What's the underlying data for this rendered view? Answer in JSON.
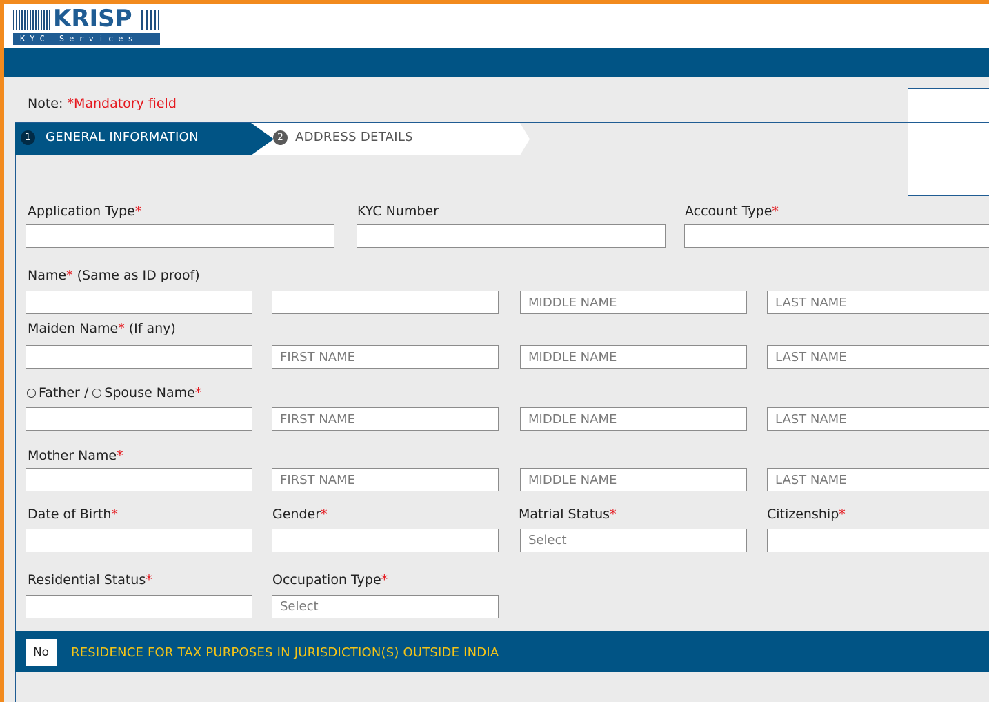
{
  "brand": {
    "logo_text": "KRISP",
    "logo_subtitle": "KYC Services"
  },
  "note": {
    "prefix": "Note:",
    "mandatory": "*Mandatory field"
  },
  "steps": [
    {
      "number": "1",
      "label": "GENERAL INFORMATION",
      "active": true
    },
    {
      "number": "2",
      "label": "ADDRESS DETAILS",
      "active": false
    }
  ],
  "fields": {
    "application_type": {
      "label": "Application Type",
      "required": "*"
    },
    "kyc_number": {
      "label": "KYC Number"
    },
    "account_type": {
      "label": "Account Type",
      "required": "*"
    },
    "name": {
      "label": "Name",
      "required": "*",
      "hint": " (Same as ID proof)",
      "middle_placeholder": "MIDDLE NAME",
      "last_placeholder": "LAST NAME"
    },
    "maiden_name": {
      "label": "Maiden Name",
      "required": "*",
      "hint": " (If any)",
      "first_placeholder": "FIRST NAME",
      "middle_placeholder": "MIDDLE NAME",
      "last_placeholder": "LAST NAME"
    },
    "father_spouse": {
      "option1": "Father /",
      "option2": "Spouse Name",
      "required": "*",
      "first_placeholder": "FIRST NAME",
      "middle_placeholder": "MIDDLE NAME",
      "last_placeholder": "LAST NAME"
    },
    "mother_name": {
      "label": "Mother Name",
      "required": "*",
      "first_placeholder": "FIRST NAME",
      "middle_placeholder": "MIDDLE NAME",
      "last_placeholder": "LAST NAME"
    },
    "date_of_birth": {
      "label": "Date of Birth",
      "required": "*"
    },
    "gender": {
      "label": "Gender",
      "required": "*"
    },
    "marital_status": {
      "label": "Matrial Status",
      "required": "*",
      "value": "Select"
    },
    "citizenship": {
      "label": "Citizenship",
      "required": "*"
    },
    "residential_status": {
      "label": "Residential Status",
      "required": "*"
    },
    "occupation_type": {
      "label": "Occupation Type",
      "required": "*",
      "value": "Select"
    }
  },
  "tax_residence": {
    "toggle_value": "No",
    "label": "RESIDENCE FOR TAX PURPOSES IN JURISDICTION(S) OUTSIDE INDIA"
  },
  "colors": {
    "primary": "#015485",
    "accent_border": "#f28a1d",
    "required": "#e5191f",
    "tax_label": "#f4c417"
  }
}
